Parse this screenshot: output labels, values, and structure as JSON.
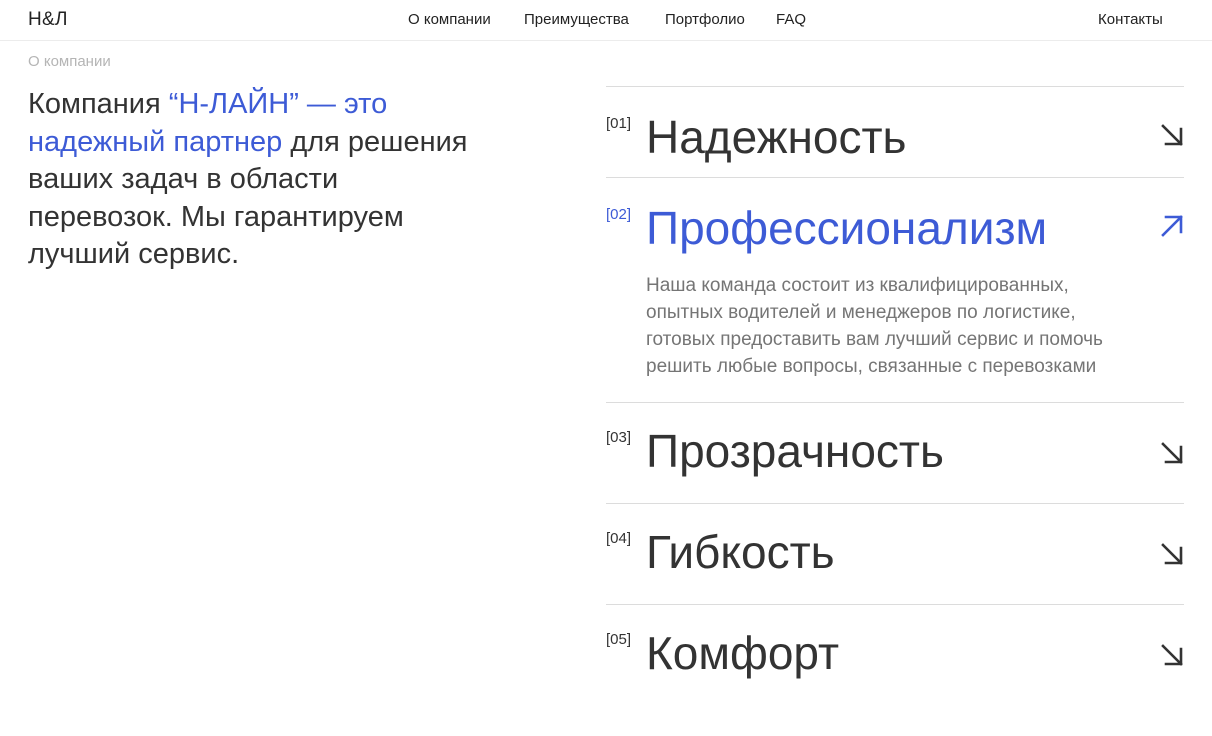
{
  "header": {
    "logo": "Н&Л",
    "nav": [
      {
        "label": "О компании"
      },
      {
        "label": "Преимущества"
      },
      {
        "label": "Портфолио"
      },
      {
        "label": "FAQ"
      }
    ],
    "contacts": "Контакты"
  },
  "breadcrumb": "О компании",
  "intro": {
    "part1": "Компания ",
    "accent": "“Н-ЛАЙН” — это надежный партнер",
    "part2": " для решения ваших задач в области перевозок. Мы гарантируем лучший сервис."
  },
  "colors": {
    "accent": "#3d5bd6",
    "text": "#333333",
    "muted": "#757575",
    "divider": "#dcdcdc"
  },
  "advantages": [
    {
      "num": "[01]",
      "title": "Надежность",
      "arrow": "arrow-down-right-icon"
    },
    {
      "num": "[02]",
      "title": "Профессионализм",
      "arrow": "arrow-up-right-icon",
      "text": "Наша команда состоит из квалифицированных, опытных водителей и менеджеров по логистике, готовых предоставить вам лучший сервис и помочь решить любые вопросы, связанные с перевозками"
    },
    {
      "num": "[03]",
      "title": "Прозрачность",
      "arrow": "arrow-down-right-icon"
    },
    {
      "num": "[04]",
      "title": "Гибкость",
      "arrow": "arrow-down-right-icon"
    },
    {
      "num": "[05]",
      "title": "Комфорт",
      "arrow": "arrow-down-right-icon"
    }
  ]
}
